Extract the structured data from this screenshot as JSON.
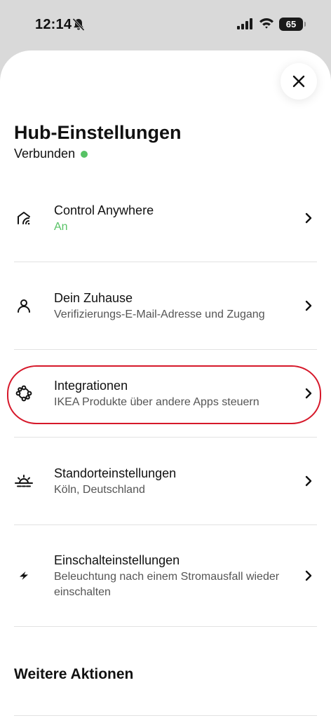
{
  "status_bar": {
    "time": "12:14",
    "battery": "65",
    "icons": [
      "bell-slash-icon",
      "signal-icon",
      "wifi-icon",
      "battery-icon"
    ]
  },
  "sheet": {
    "title": "Hub-Einstellungen",
    "status": "Verbunden",
    "status_color": "#57c265",
    "close_icon": "close-icon"
  },
  "items": [
    {
      "icon": "home-wifi-icon",
      "title": "Control Anywhere",
      "subtitle": "An",
      "subtitle_color": "#57c265"
    },
    {
      "icon": "person-icon",
      "title": "Dein Zuhause",
      "subtitle": "Verifizierungs-E-Mail-Adresse und Zugang"
    },
    {
      "icon": "integrations-icon",
      "title": "Integrationen",
      "subtitle": "IKEA Produkte über andere Apps steuern"
    },
    {
      "icon": "sunrise-icon",
      "title": "Standorteinstellungen",
      "subtitle": "Köln, Deutschland"
    },
    {
      "icon": "lightning-icon",
      "title": "Einschalteinstellungen",
      "subtitle": "Beleuchtung nach einem Stromausfall wieder einschalten"
    }
  ],
  "section": {
    "title": "Weitere Aktionen"
  },
  "highlight_color": "#d6182a"
}
